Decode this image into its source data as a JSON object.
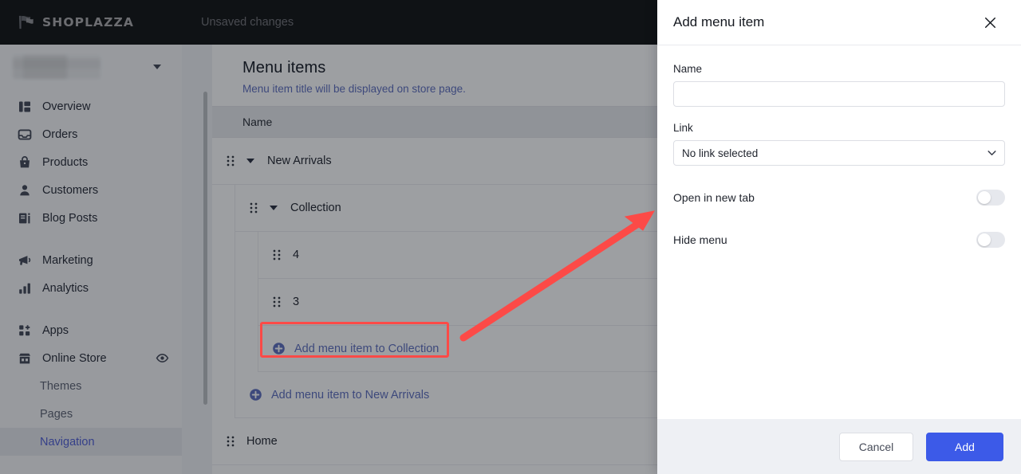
{
  "topbar": {
    "brand": "SHOPLAZZA",
    "brand_logo_icon": "shoplazza-flag-logo",
    "status_text": "Unsaved changes"
  },
  "sidebar": {
    "store_picker": {
      "name_redacted": "",
      "caret_icon": "chevron-down-icon"
    },
    "items": [
      {
        "label": "Overview",
        "icon": "dashboard-icon",
        "level": 0,
        "active": false
      },
      {
        "label": "Orders",
        "icon": "inbox-icon",
        "level": 0,
        "active": false
      },
      {
        "label": "Products",
        "icon": "bag-icon",
        "level": 0,
        "active": false
      },
      {
        "label": "Customers",
        "icon": "person-icon",
        "level": 0,
        "active": false
      },
      {
        "label": "Blog Posts",
        "icon": "blog-icon",
        "level": 0,
        "active": false
      },
      {
        "label": "Marketing",
        "icon": "megaphone-icon",
        "level": 0,
        "active": false
      },
      {
        "label": "Analytics",
        "icon": "bar-chart-icon",
        "level": 0,
        "active": false
      },
      {
        "label": "Apps",
        "icon": "apps-grid-icon",
        "level": 0,
        "active": false
      },
      {
        "label": "Online Store",
        "icon": "storefront-icon",
        "level": 0,
        "active": false,
        "trailing_icon": "eye-icon"
      },
      {
        "label": "Themes",
        "icon": "",
        "level": 1,
        "active": false
      },
      {
        "label": "Pages",
        "icon": "",
        "level": 1,
        "active": false
      },
      {
        "label": "Navigation",
        "icon": "",
        "level": 1,
        "active": true
      }
    ]
  },
  "main": {
    "card_title": "Menu items",
    "card_subtitle": "Menu item title will be displayed on store page.",
    "table_header": "Name",
    "rows": [
      {
        "label": "New Arrivals",
        "type": "group",
        "level": 0,
        "expanded": true,
        "drag_icon": "drag-handle-icon",
        "caret_icon": "caret-down-icon"
      },
      {
        "label": "Collection",
        "type": "group",
        "level": 1,
        "expanded": true,
        "drag_icon": "drag-handle-icon",
        "caret_icon": "caret-down-icon"
      },
      {
        "label": "4",
        "type": "item",
        "level": 2,
        "drag_icon": "drag-handle-icon"
      },
      {
        "label": "3",
        "type": "item",
        "level": 2,
        "drag_icon": "drag-handle-icon"
      },
      {
        "label": "Add menu item to Collection",
        "type": "add",
        "level": 2,
        "plus_icon": "plus-circle-icon",
        "highlighted": true
      },
      {
        "label": "Add menu item to New Arrivals",
        "type": "add",
        "level": 1,
        "plus_icon": "plus-circle-icon",
        "highlighted": false
      },
      {
        "label": "Home",
        "type": "item",
        "level": 0,
        "drag_icon": "drag-handle-icon"
      }
    ]
  },
  "panel": {
    "title": "Add menu item",
    "close_icon": "close-icon",
    "name_field": {
      "label": "Name",
      "value": "",
      "placeholder": ""
    },
    "link_field": {
      "label": "Link",
      "selected": "No link selected",
      "chevron_icon": "chevron-down-icon"
    },
    "toggles": [
      {
        "label": "Open in new tab",
        "on": false
      },
      {
        "label": "Hide menu",
        "on": false
      }
    ],
    "footer": {
      "cancel_label": "Cancel",
      "add_label": "Add"
    }
  },
  "annotation": {
    "accent_color": "#fc4a47",
    "highlight_target": "Add menu item to Collection",
    "arrow": "arrow-pointing-up-right"
  },
  "colors": {
    "brand_dark": "#16171a",
    "sidebar_bg": "#f6f7f9",
    "link_blue": "#5b6bbd",
    "primary_button": "#3c5ae8",
    "annotation_red": "#fc4a47"
  }
}
